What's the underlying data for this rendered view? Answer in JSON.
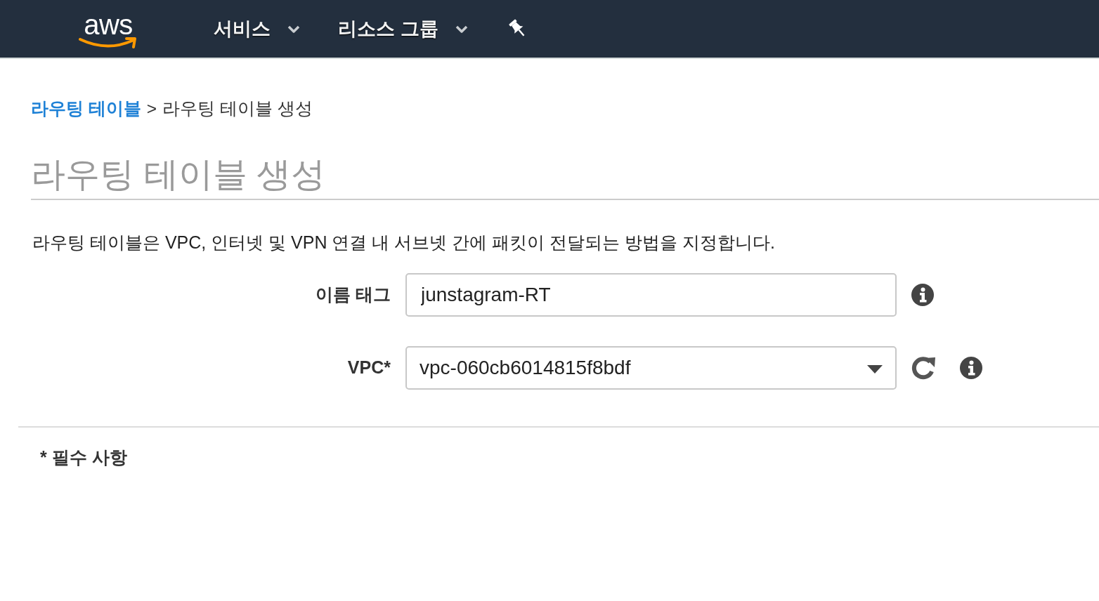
{
  "navbar": {
    "logo": "aws",
    "menus": [
      {
        "label": "서비스"
      },
      {
        "label": "리소스 그룹"
      }
    ]
  },
  "breadcrumb": {
    "link": "라우팅 테이블",
    "separator": ">",
    "current": "라우팅 테이블 생성"
  },
  "title": "라우팅 테이블 생성",
  "description": "라우팅 테이블은 VPC, 인터넷 및 VPN 연결 내 서브넷 간에 패킷이 전달되는 방법을 지정합니다.",
  "fields": [
    {
      "kind": "text",
      "label": "이름 태그",
      "value": "junstagram-RT"
    },
    {
      "kind": "select",
      "label": "VPC*",
      "value": "vpc-060cb6014815f8bdf"
    }
  ],
  "footnote": "* 필수 사항"
}
